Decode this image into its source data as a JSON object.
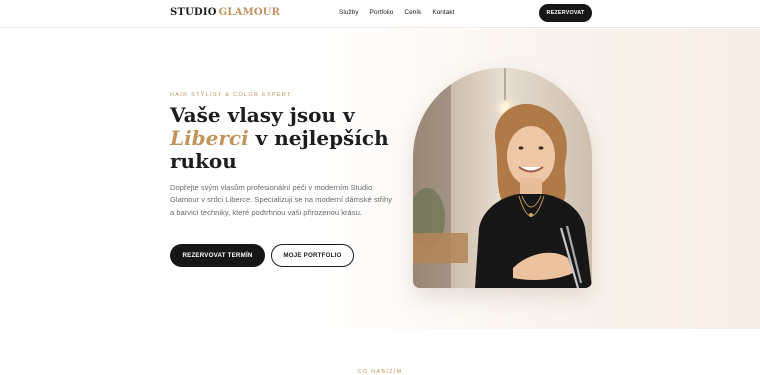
{
  "header": {
    "brand_primary": "STUDIO",
    "brand_accent": "GLAMOUR",
    "nav": [
      "Služby",
      "Portfolio",
      "Ceník",
      "Kontakt"
    ],
    "cta": "REZERVOVAT"
  },
  "hero": {
    "eyebrow": "HAIR STYLIST & COLOR EXPERT",
    "title_line1": "Vaše vlasy jsou v",
    "title_accent": "Liberci",
    "title_line2": "v nejlepších",
    "title_line3": "rukou",
    "description": "Dopřejte svým vlasům profesionální péči v moderním Studio Glamour v srdci Liberce. Specializuji se na moderní dámské střihy a barvicí techniky, které podtrhnou vaši přirozenou krásu.",
    "primary_button": "REZERVOVAT TERMÍN",
    "secondary_button": "MOJE PORTFOLIO"
  },
  "next_section": {
    "label": "CO NABÍZÍM"
  },
  "colors": {
    "accent": "#c3935c",
    "dark": "#161616",
    "text_muted": "#6a6a6a"
  }
}
